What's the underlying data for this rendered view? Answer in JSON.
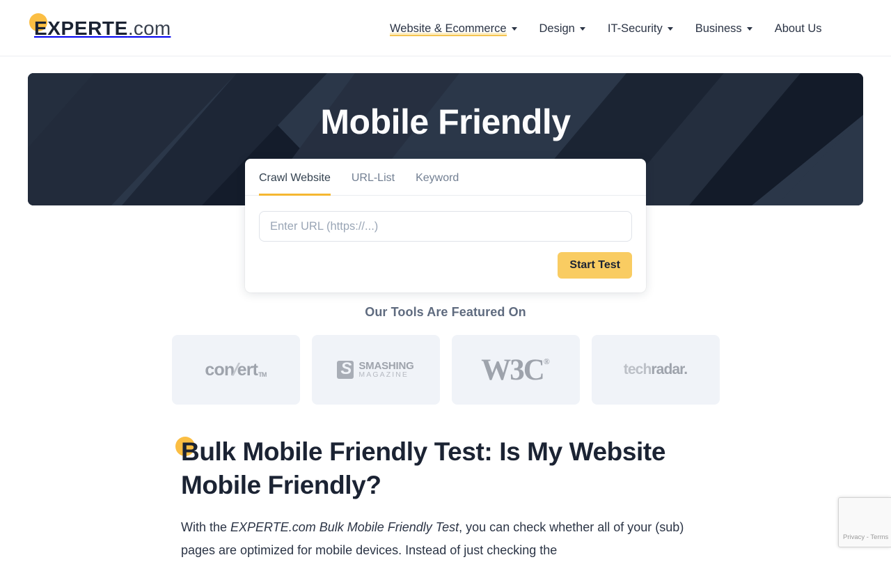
{
  "brand": {
    "name_bold": "EXPERTE",
    "name_light": ".com",
    "accent_color": "#fbbe43"
  },
  "nav": {
    "items": [
      {
        "label": "Website & Ecommerce",
        "has_dropdown": true,
        "active": true
      },
      {
        "label": "Design",
        "has_dropdown": true,
        "active": false
      },
      {
        "label": "IT-Security",
        "has_dropdown": true,
        "active": false
      },
      {
        "label": "Business",
        "has_dropdown": true,
        "active": false
      },
      {
        "label": "About Us",
        "has_dropdown": false,
        "active": false
      }
    ]
  },
  "hero": {
    "title": "Mobile Friendly",
    "background_color": "#222b3b"
  },
  "search_card": {
    "tabs": [
      {
        "label": "Crawl Website",
        "active": true
      },
      {
        "label": "URL-List",
        "active": false
      },
      {
        "label": "Keyword",
        "active": false
      }
    ],
    "url_input": {
      "value": "",
      "placeholder": "Enter URL (https://...)"
    },
    "submit_label": "Start Test",
    "submit_color": "#f9cc62"
  },
  "featured": {
    "title": "Our Tools Are Featured On",
    "logos": [
      {
        "name": "convert",
        "text": "convert",
        "tm": "TM"
      },
      {
        "name": "smashing-magazine",
        "line1": "SMASHING",
        "line2": "MAGAZINE"
      },
      {
        "name": "w3c",
        "text": "W3C",
        "registered": "®"
      },
      {
        "name": "techradar",
        "part1": "tech",
        "part2": "radar."
      }
    ]
  },
  "article": {
    "heading": "Bulk Mobile Friendly Test: Is My Website Mobile Friendly?",
    "paragraph_part1": "With the ",
    "paragraph_emphasis": "EXPERTE.com Bulk Mobile Friendly Test",
    "paragraph_part2": ", you can check whether all of your (sub) pages are optimized for mobile devices. Instead of just checking the"
  },
  "recaptcha": {
    "label": "Privacy - Terms"
  }
}
